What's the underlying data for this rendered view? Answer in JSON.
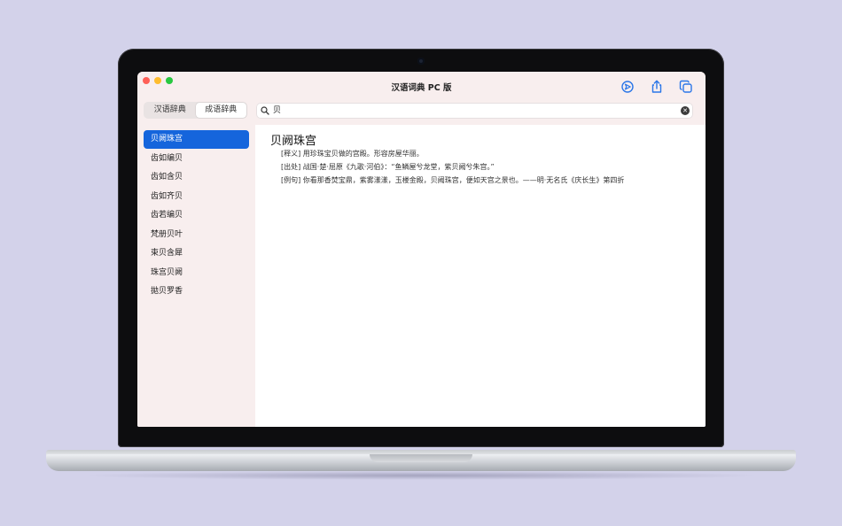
{
  "window": {
    "title": "汉语词典 PC 版"
  },
  "toolbar": {
    "icons": [
      "compass-icon",
      "share-icon",
      "copy-icon"
    ]
  },
  "tabs": [
    {
      "label": "汉语辞典",
      "active": false
    },
    {
      "label": "成语辞典",
      "active": true
    }
  ],
  "search": {
    "value": "贝"
  },
  "results": [
    {
      "label": "贝阙珠宫",
      "selected": true
    },
    {
      "label": "齿如编贝",
      "selected": false
    },
    {
      "label": "齿如含贝",
      "selected": false
    },
    {
      "label": "齿如齐贝",
      "selected": false
    },
    {
      "label": "齿若编贝",
      "selected": false
    },
    {
      "label": "梵册贝叶",
      "selected": false
    },
    {
      "label": "束贝含犀",
      "selected": false
    },
    {
      "label": "珠宫贝阙",
      "selected": false
    },
    {
      "label": "拋贝罗香",
      "selected": false
    }
  ],
  "entry": {
    "title": "贝阙珠宫",
    "definition": "[释义] 用珍珠宝贝做的宫殿。形容房屋华丽。",
    "source": "[出处] 战国·楚·屈原《九歌·河伯》：“鱼鳞屋兮龙堂，紫贝阙兮朱宫。”",
    "example": "[例句] 你看那香焚宝鼎，紫雾漾漾，玉楼金殿，贝阙珠宫，便如天宫之景也。——明·无名氏《庆长生》第四折"
  },
  "colors": {
    "background": "#d3d2ea",
    "window_chrome": "#f8eeee",
    "selection": "#1565dc",
    "toolbar_icon": "#2a76e8"
  }
}
